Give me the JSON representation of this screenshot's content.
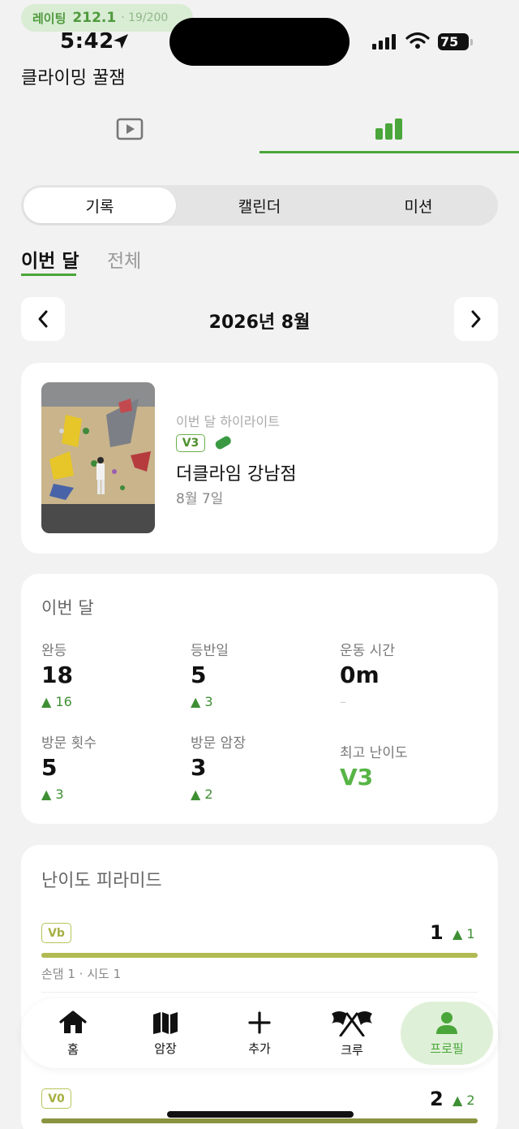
{
  "status_bar": {
    "rating_label": "레이팅",
    "rating_value": "212.1",
    "rating_progress": "· 19/200",
    "time": "5:42",
    "battery": "75"
  },
  "app": {
    "title": "클라이밍 꿀잼"
  },
  "top_tabs": [
    {
      "icon": "play-video-icon",
      "active": false
    },
    {
      "icon": "bar-chart-icon",
      "active": true
    }
  ],
  "segment": {
    "items": [
      "기록",
      "캘린더",
      "미션"
    ],
    "active_index": 0
  },
  "period_tabs": {
    "this_month": "이번 달",
    "all": "전체",
    "active": "this_month"
  },
  "month_nav": {
    "label": "2026년 8월"
  },
  "highlight": {
    "label": "이번 달 하이라이트",
    "grade": "V3",
    "hold_color": "#3a9a44",
    "gym": "더클라임 강남점",
    "date": "8월 7일"
  },
  "stats": {
    "title": "이번 달",
    "items": [
      {
        "label": "완등",
        "value": "18",
        "delta": "▲ 16"
      },
      {
        "label": "등반일",
        "value": "5",
        "delta": "▲ 3"
      },
      {
        "label": "운동 시간",
        "value": "0m",
        "delta": "–"
      },
      {
        "label": "방문 횟수",
        "value": "5",
        "delta": "▲ 3"
      },
      {
        "label": "방문 암장",
        "value": "3",
        "delta": "▲ 2"
      },
      {
        "label": "최고 난이도",
        "value": "V3"
      }
    ]
  },
  "pyramid": {
    "title": "난이도 피라미드",
    "rows": [
      {
        "grade": "Vb",
        "count": "1",
        "delta": "▲ 1",
        "sub": "손댐 1 · 시도 1",
        "fill_fraction": 1.0
      },
      {
        "grade": "V0",
        "count": "2",
        "delta": "▲ 2",
        "fill_fraction": 1.0
      }
    ]
  },
  "bottom_nav": {
    "items": [
      {
        "label": "홈",
        "icon": "home-icon"
      },
      {
        "label": "암장",
        "icon": "map-icon"
      },
      {
        "label": "추가",
        "icon": "plus-icon"
      },
      {
        "label": "크루",
        "icon": "crossed-flags-icon"
      },
      {
        "label": "프로필",
        "icon": "person-icon"
      }
    ],
    "active_index": 4
  },
  "colors": {
    "accent": "#4aa63a",
    "accent_light": "#dff0d8",
    "pyramid_bar": "#b2ba52",
    "background": "#f2f2f2"
  }
}
